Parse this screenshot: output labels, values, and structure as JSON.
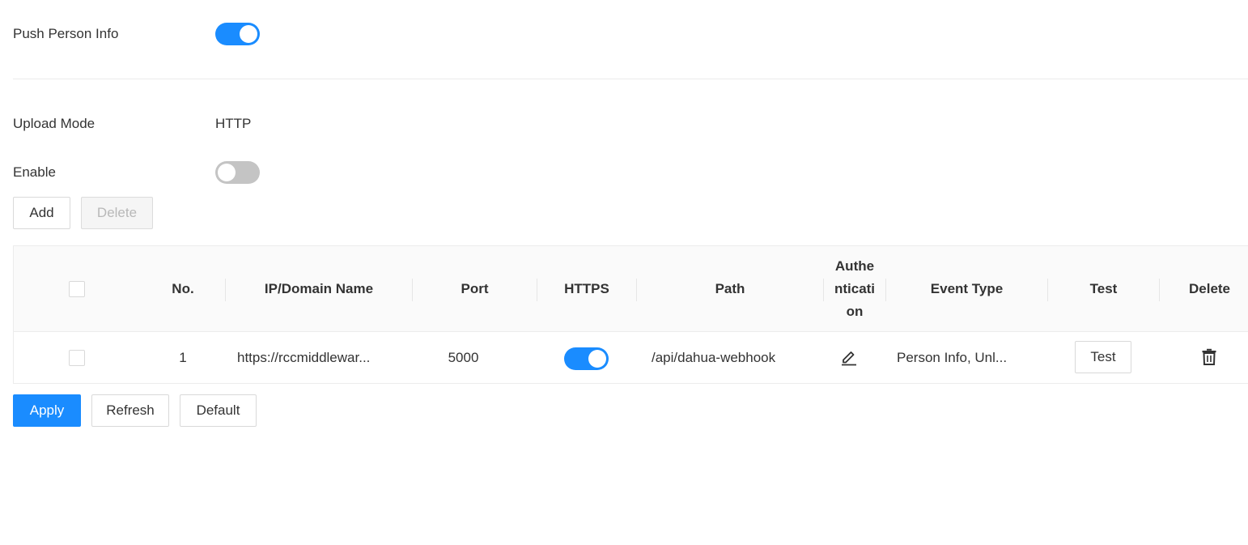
{
  "push_person_info": {
    "label": "Push Person Info",
    "enabled": true
  },
  "upload_mode": {
    "label": "Upload Mode",
    "value": "HTTP"
  },
  "enable": {
    "label": "Enable",
    "enabled": false
  },
  "toolbar": {
    "add_label": "Add",
    "delete_label": "Delete"
  },
  "table": {
    "headers": {
      "no": "No.",
      "ip": "IP/Domain Name",
      "port": "Port",
      "https": "HTTPS",
      "path": "Path",
      "auth": "Authe\nnticati\non",
      "event_type": "Event Type",
      "test": "Test",
      "delete": "Delete"
    },
    "rows": [
      {
        "no": "1",
        "ip": "https://rccmiddlewar...",
        "port": "5000",
        "https": true,
        "path": "/api/dahua-webhook",
        "event_type": "Person Info, Unl...",
        "test_label": "Test"
      }
    ]
  },
  "footer": {
    "apply_label": "Apply",
    "refresh_label": "Refresh",
    "default_label": "Default"
  },
  "colors": {
    "accent": "#1a8cff",
    "toggle_off": "#c4c4c4",
    "header_bg": "#fafafa"
  }
}
